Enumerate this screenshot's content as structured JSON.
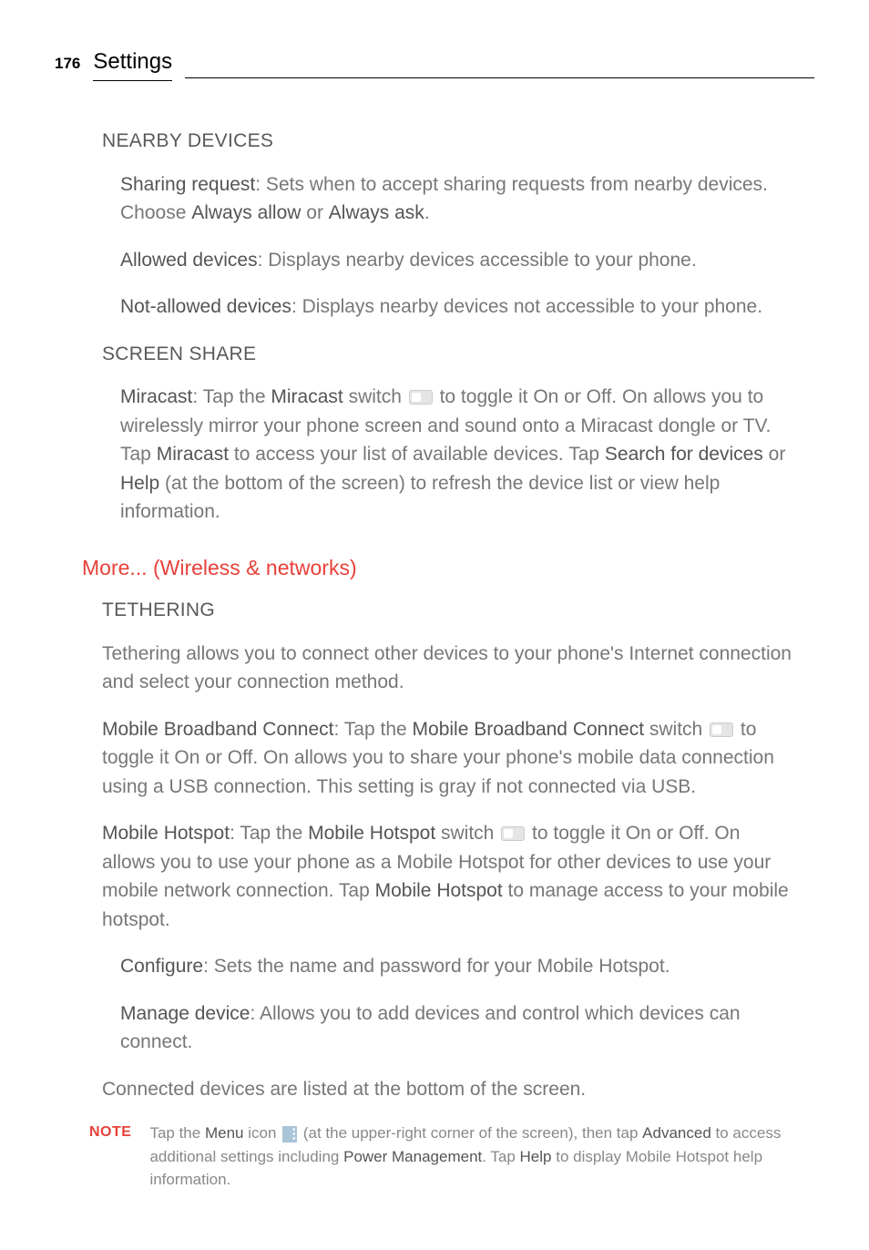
{
  "header": {
    "pageNumber": "176",
    "title": "Settings"
  },
  "nearbyDevices": {
    "heading": "NEARBY DEVICES",
    "sharingRequest": {
      "label": "Sharing request",
      "text1": ": Sets when to accept sharing requests from nearby devices. Choose ",
      "opt1": "Always allow",
      "or": " or ",
      "opt2": "Always ask",
      "end": "."
    },
    "allowedDevices": {
      "label": "Allowed devices",
      "text": ": Displays nearby devices accessible to your phone."
    },
    "notAllowedDevices": {
      "label": "Not-allowed devices",
      "text": ": Displays nearby devices not accessible to your phone."
    }
  },
  "screenShare": {
    "heading": "SCREEN SHARE",
    "miracast": {
      "label": "Miracast",
      "t1": ": Tap the ",
      "b1": "Miracast",
      "t2": " switch ",
      "t3": " to toggle it On or Off. On allows you to wirelessly mirror your phone screen and sound onto a Miracast dongle or TV. Tap ",
      "b2": "Miracast",
      "t4": " to access your list of available devices. Tap ",
      "b3": "Search for devices",
      "t5": " or ",
      "b4": "Help",
      "t6": " (at the bottom of the screen) to refresh the device list or view help information."
    }
  },
  "moreSection": {
    "title": "More... (Wireless & networks)"
  },
  "tethering": {
    "heading": "TETHERING",
    "intro": "Tethering allows you to connect other devices to your phone's Internet connection and select your connection method.",
    "mbc": {
      "label": "Mobile Broadband Connect",
      "t1": ": Tap the ",
      "b1": "Mobile Broadband Connect",
      "t2": " switch ",
      "t3": " to toggle it On or Off. On allows you to share your phone's mobile data connection using a USB connection. This setting is gray if not connected via USB."
    },
    "mh": {
      "label": "Mobile Hotspot",
      "t1": ": Tap the ",
      "b1": "Mobile Hotspot",
      "t2": " switch ",
      "t3": " to toggle it On or Off. On allows you to use your phone as a Mobile Hotspot for other devices to use your mobile network connection. Tap ",
      "b2": "Mobile Hotspot",
      "t4": " to manage access to your mobile hotspot."
    },
    "configure": {
      "label": "Configure",
      "text": ": Sets the name and password for your Mobile Hotspot."
    },
    "manage": {
      "label": "Manage device",
      "text": ": Allows you to add devices and control which devices can connect."
    },
    "connected": "Connected devices are listed at the bottom of the screen."
  },
  "note": {
    "label": "NOTE",
    "t1": "Tap the ",
    "b1": "Menu",
    "t2": " icon ",
    "t3": " (at the upper-right corner of the screen), then tap ",
    "b2": "Advanced",
    "t4": " to access additional settings including ",
    "b3": "Power Management",
    "t5": ". Tap ",
    "b4": "Help",
    "t6": " to display Mobile Hotspot help information."
  }
}
